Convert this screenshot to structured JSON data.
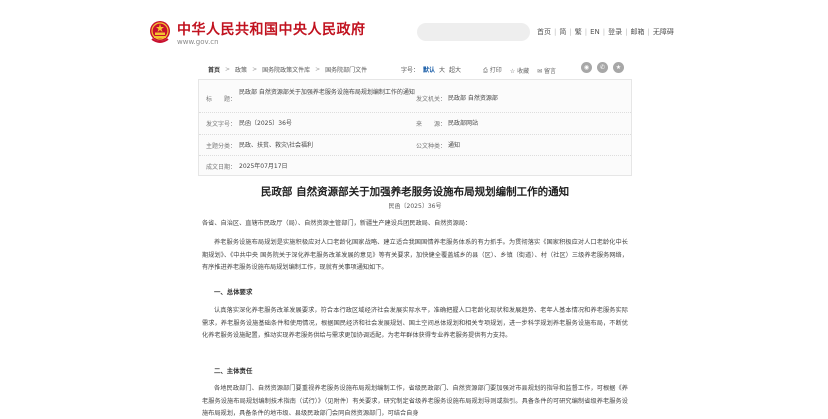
{
  "header": {
    "site_title": "中华人民共和国中央人民政府",
    "site_url": "www.gov.cn",
    "search_placeholder": "",
    "nav": [
      "首页",
      "简",
      "繁",
      "EN",
      "登录",
      "邮箱",
      "无障碍"
    ]
  },
  "toolbar": {
    "breadcrumbs": [
      "首页",
      "政策",
      "国务院政策文件库",
      "国务院部门文件"
    ],
    "font_size_label": "字号：",
    "font_sizes": [
      "默认",
      "大",
      "超大"
    ],
    "actions": [
      "打印",
      "收藏",
      "留言"
    ]
  },
  "info": {
    "title_label": "标　　题：",
    "title_value": "民政部 自然资源部关于加强养老服务设施布局规划编制工作的通知",
    "issuer_label": "发文机关：",
    "issuer_value": "民政部 自然资源部",
    "docno_label": "发文字号：",
    "docno_value": "民函〔2025〕36号",
    "source_label": "来　　源：",
    "source_value": "民政部网站",
    "topic_label": "主题分类：",
    "topic_value": "民政、扶贫、救灾\\社会福利",
    "type_label": "公文种类：",
    "type_value": "通知",
    "date_label": "成文日期：",
    "date_value": "2025年07月17日"
  },
  "article": {
    "title": "民政部 自然资源部关于加强养老服务设施布局规划编制工作的通知",
    "doc_no": "民函〔2025〕36号",
    "salutation": "各省、自治区、直辖市民政厅（局）、自然资源主管部门，新疆生产建设兵团民政局、自然资源局：",
    "intro": "养老服务设施布局规划是实施积极应对人口老龄化国家战略、建立适合我国国情养老服务体系的有力抓手。为贯彻落实《国家积极应对人口老龄化中长期规划》、《中共中央 国务院关于深化养老服务改革发展的意见》等有关要求，加快健全覆盖城乡的县（区）、乡镇（街道）、村（社区）三级养老服务网络，有序推进养老服务设施布局规划编制工作，现就有关事项通知如下。",
    "section1": "一、总体要求",
    "para1": "认真落实深化养老服务改革发展要求，符合本行政区域经济社会发展实际水平，准确把握人口老龄化现状和发展趋势、老年人基本情况和养老服务实际需求，养老服务设施基础条件和使用情况，根据国民经济和社会发展规划、国土空间总体规划和相关专项规划，进一步科学规划养老服务设施布局，不断优化养老服务设施配置，推动实现养老服务供给与需求更加协调适配，为老年群体获得专业养老服务提供有力支持。",
    "section2": "二、主体责任",
    "para2": "各地民政部门、自然资源部门要重视养老服务设施布局规划编制工作，省级民政部门、自然资源部门要加强对市县规划的指导和监督工作，可根据《养老服务设施布局规划编制技术指南（试行）》（见附件）有关要求，研究制定省级养老服务设施布局规划导则或指引。具备条件的可研究编制省级养老服务设施布局规划，具备条件的地市级、县级民政部门会同自然资源部门，可结合自身"
  }
}
